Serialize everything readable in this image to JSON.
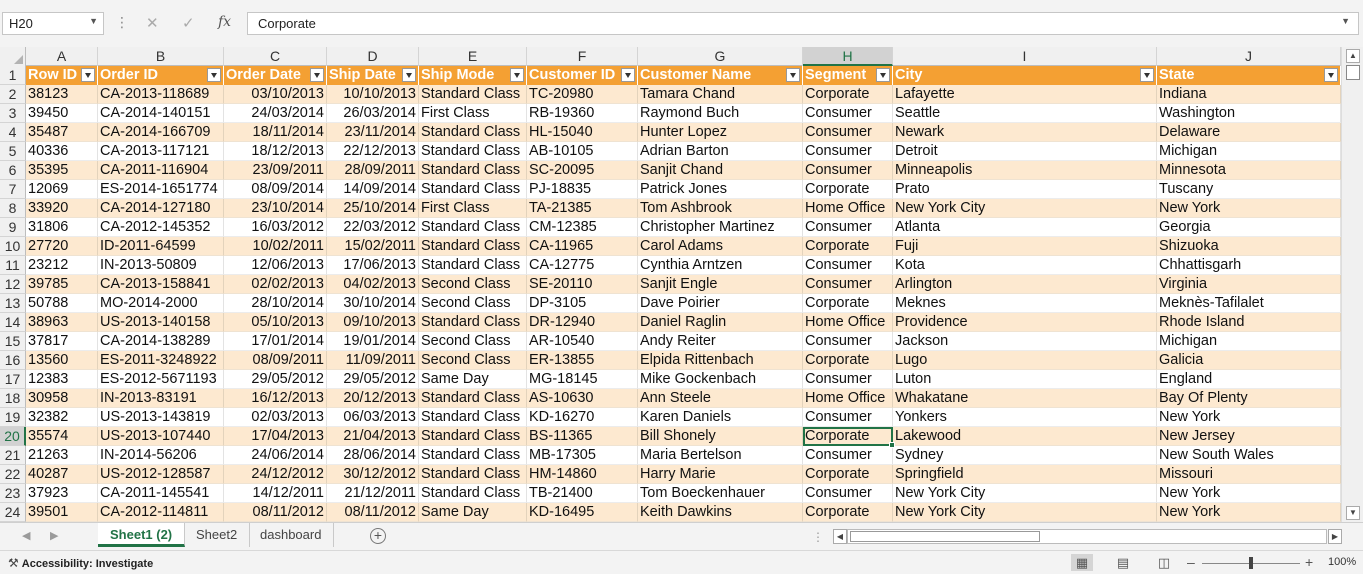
{
  "formula_bar": {
    "name_box": "H20",
    "cancel_icon": "✕",
    "enter_icon": "✓",
    "fx_label": "fx",
    "value": "Corporate"
  },
  "columns": [
    "A",
    "B",
    "C",
    "D",
    "E",
    "F",
    "G",
    "H",
    "I",
    "J"
  ],
  "selected_column": "H",
  "headers": [
    "Row ID",
    "Order ID",
    "Order Date",
    "Ship Date",
    "Ship Mode",
    "Customer ID",
    "Customer Name",
    "Segment",
    "City",
    "State"
  ],
  "rows": [
    [
      "38123",
      "CA-2013-118689",
      "03/10/2013",
      "10/10/2013",
      "Standard Class",
      "TC-20980",
      "Tamara Chand",
      "Corporate",
      "Lafayette",
      "Indiana"
    ],
    [
      "39450",
      "CA-2014-140151",
      "24/03/2014",
      "26/03/2014",
      "First Class",
      "RB-19360",
      "Raymond Buch",
      "Consumer",
      "Seattle",
      "Washington"
    ],
    [
      "35487",
      "CA-2014-166709",
      "18/11/2014",
      "23/11/2014",
      "Standard Class",
      "HL-15040",
      "Hunter Lopez",
      "Consumer",
      "Newark",
      "Delaware"
    ],
    [
      "40336",
      "CA-2013-117121",
      "18/12/2013",
      "22/12/2013",
      "Standard Class",
      "AB-10105",
      "Adrian Barton",
      "Consumer",
      "Detroit",
      "Michigan"
    ],
    [
      "35395",
      "CA-2011-116904",
      "23/09/2011",
      "28/09/2011",
      "Standard Class",
      "SC-20095",
      "Sanjit Chand",
      "Consumer",
      "Minneapolis",
      "Minnesota"
    ],
    [
      "12069",
      "ES-2014-1651774",
      "08/09/2014",
      "14/09/2014",
      "Standard Class",
      "PJ-18835",
      "Patrick Jones",
      "Corporate",
      "Prato",
      "Tuscany"
    ],
    [
      "33920",
      "CA-2014-127180",
      "23/10/2014",
      "25/10/2014",
      "First Class",
      "TA-21385",
      "Tom Ashbrook",
      "Home Office",
      "New York City",
      "New York"
    ],
    [
      "31806",
      "CA-2012-145352",
      "16/03/2012",
      "22/03/2012",
      "Standard Class",
      "CM-12385",
      "Christopher Martinez",
      "Consumer",
      "Atlanta",
      "Georgia"
    ],
    [
      "27720",
      "ID-2011-64599",
      "10/02/2011",
      "15/02/2011",
      "Standard Class",
      "CA-11965",
      "Carol Adams",
      "Corporate",
      "Fuji",
      "Shizuoka"
    ],
    [
      "23212",
      "IN-2013-50809",
      "12/06/2013",
      "17/06/2013",
      "Standard Class",
      "CA-12775",
      "Cynthia Arntzen",
      "Consumer",
      "Kota",
      "Chhattisgarh"
    ],
    [
      "39785",
      "CA-2013-158841",
      "02/02/2013",
      "04/02/2013",
      "Second Class",
      "SE-20110",
      "Sanjit Engle",
      "Consumer",
      "Arlington",
      "Virginia"
    ],
    [
      "50788",
      "MO-2014-2000",
      "28/10/2014",
      "30/10/2014",
      "Second Class",
      "DP-3105",
      "Dave Poirier",
      "Corporate",
      "Meknes",
      "Meknès-Tafilalet"
    ],
    [
      "38963",
      "US-2013-140158",
      "05/10/2013",
      "09/10/2013",
      "Standard Class",
      "DR-12940",
      "Daniel Raglin",
      "Home Office",
      "Providence",
      "Rhode Island"
    ],
    [
      "37817",
      "CA-2014-138289",
      "17/01/2014",
      "19/01/2014",
      "Second Class",
      "AR-10540",
      "Andy Reiter",
      "Consumer",
      "Jackson",
      "Michigan"
    ],
    [
      "13560",
      "ES-2011-3248922",
      "08/09/2011",
      "11/09/2011",
      "Second Class",
      "ER-13855",
      "Elpida Rittenbach",
      "Corporate",
      "Lugo",
      "Galicia"
    ],
    [
      "12383",
      "ES-2012-5671193",
      "29/05/2012",
      "29/05/2012",
      "Same Day",
      "MG-18145",
      "Mike Gockenbach",
      "Consumer",
      "Luton",
      "England"
    ],
    [
      "30958",
      "IN-2013-83191",
      "16/12/2013",
      "20/12/2013",
      "Standard Class",
      "AS-10630",
      "Ann Steele",
      "Home Office",
      "Whakatane",
      "Bay Of Plenty"
    ],
    [
      "32382",
      "US-2013-143819",
      "02/03/2013",
      "06/03/2013",
      "Standard Class",
      "KD-16270",
      "Karen Daniels",
      "Consumer",
      "Yonkers",
      "New York"
    ],
    [
      "35574",
      "US-2013-107440",
      "17/04/2013",
      "21/04/2013",
      "Standard Class",
      "BS-11365",
      "Bill Shonely",
      "Corporate",
      "Lakewood",
      "New Jersey"
    ],
    [
      "21263",
      "IN-2014-56206",
      "24/06/2014",
      "28/06/2014",
      "Standard Class",
      "MB-17305",
      "Maria Bertelson",
      "Consumer",
      "Sydney",
      "New South Wales"
    ],
    [
      "40287",
      "US-2012-128587",
      "24/12/2012",
      "30/12/2012",
      "Standard Class",
      "HM-14860",
      "Harry Marie",
      "Corporate",
      "Springfield",
      "Missouri"
    ],
    [
      "37923",
      "CA-2011-145541",
      "14/12/2011",
      "21/12/2011",
      "Standard Class",
      "TB-21400",
      "Tom Boeckenhauer",
      "Consumer",
      "New York City",
      "New York"
    ],
    [
      "39501",
      "CA-2012-114811",
      "08/11/2012",
      "08/11/2012",
      "Same Day",
      "KD-16495",
      "Keith Dawkins",
      "Corporate",
      "New York City",
      "New York"
    ]
  ],
  "sheet_tabs": [
    "Sheet1 (2)",
    "Sheet2",
    "dashboard"
  ],
  "active_tab": 0,
  "status": {
    "accessibility": "Accessibility: Investigate",
    "zoom": "100%"
  },
  "colors": {
    "header_fill": "#f4a033",
    "band_fill": "#fde9d0",
    "accent": "#217346"
  }
}
